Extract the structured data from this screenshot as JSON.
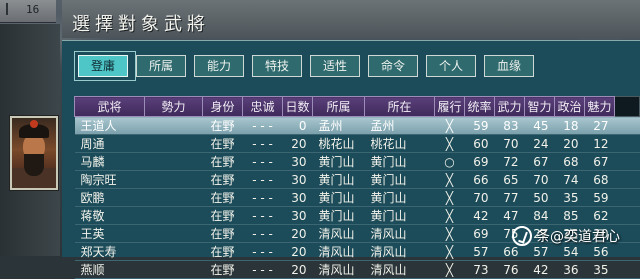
{
  "window": {
    "title": "選擇對象武將",
    "top_counter": "16"
  },
  "tabs": [
    {
      "label": "登庸",
      "active": true
    },
    {
      "label": "所属",
      "active": false
    },
    {
      "label": "能力",
      "active": false
    },
    {
      "label": "特技",
      "active": false
    },
    {
      "label": "适性",
      "active": false
    },
    {
      "label": "命令",
      "active": false
    },
    {
      "label": "个人",
      "active": false
    },
    {
      "label": "血缘",
      "active": false
    }
  ],
  "table": {
    "headers": [
      "武将",
      "勢力",
      "身份",
      "忠诚",
      "日数",
      "所属",
      "所在",
      "履行",
      "统率",
      "武力",
      "智力",
      "政治",
      "魅力"
    ],
    "rows": [
      [
        "王道人",
        "",
        "在野",
        "- - -",
        "0",
        "孟州",
        "孟州",
        "╳",
        "59",
        "83",
        "45",
        "18",
        "27"
      ],
      [
        "周通",
        "",
        "在野",
        "- - -",
        "20",
        "桃花山",
        "桃花山",
        "╳",
        "60",
        "70",
        "24",
        "20",
        "12"
      ],
      [
        "马麟",
        "",
        "在野",
        "- - -",
        "30",
        "黄门山",
        "黄门山",
        "○",
        "69",
        "72",
        "67",
        "68",
        "67"
      ],
      [
        "陶宗旺",
        "",
        "在野",
        "- - -",
        "30",
        "黄门山",
        "黄门山",
        "╳",
        "66",
        "65",
        "70",
        "74",
        "68"
      ],
      [
        "欧鹏",
        "",
        "在野",
        "- - -",
        "30",
        "黄门山",
        "黄门山",
        "╳",
        "70",
        "77",
        "50",
        "35",
        "59"
      ],
      [
        "蒋敬",
        "",
        "在野",
        "- - -",
        "30",
        "黄门山",
        "黄门山",
        "╳",
        "42",
        "47",
        "84",
        "85",
        "62"
      ],
      [
        "王英",
        "",
        "在野",
        "- - -",
        "20",
        "清风山",
        "清风山",
        "╳",
        "69",
        "75",
        "27",
        "25",
        "10"
      ],
      [
        "郑天寿",
        "",
        "在野",
        "- - -",
        "20",
        "清风山",
        "清风山",
        "╳",
        "57",
        "66",
        "57",
        "54",
        "56"
      ],
      [
        "燕顺",
        "",
        "在野",
        "- - -",
        "20",
        "清风山",
        "清风山",
        "╳",
        "73",
        "76",
        "42",
        "36",
        "35"
      ]
    ],
    "selected_row": 0
  },
  "watermark": {
    "text": "条@奕道君心"
  },
  "colors": {
    "panel": "#1c4c5a",
    "header": "#5a3f7a",
    "tab_active": "#4ec6c8",
    "selected_row": "#a9c6cf"
  }
}
